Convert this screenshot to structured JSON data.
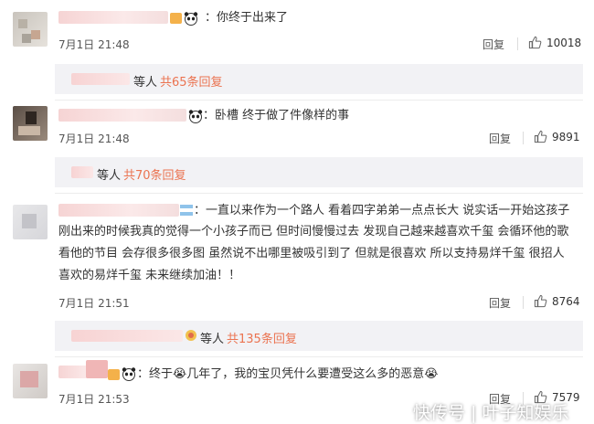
{
  "comments": [
    {
      "text_lines": [
        "你终于出来了"
      ],
      "time": "7月1日 21:48",
      "reply_label": "回复",
      "likes": "10018",
      "sub_replies": {
        "who": "等人",
        "count": "共65条回复"
      }
    },
    {
      "text_lines": [
        "卧槽 终于做了件像样的事"
      ],
      "time": "7月1日 21:48",
      "reply_label": "回复",
      "likes": "9891",
      "sub_replies": {
        "who": "等人",
        "count": "共70条回复"
      }
    },
    {
      "text_lines": [
        "一直以来作为一个路人 看着四字弟弟一点点长大 说实话一开始这孩子",
        "刚出来的时候我真的觉得一个小孩子而已 但时间慢慢过去 发现自己越来越喜欢千玺 会循环他的歌",
        "看他的节目 会存很多很多图 虽然说不出哪里被吸引到了 但就是很喜欢 所以支持易烊千玺 很招人",
        "喜欢的易烊千玺 未来继续加油！！"
      ],
      "time": "7月1日 21:51",
      "reply_label": "回复",
      "likes": "8764",
      "sub_replies": {
        "who": "等人",
        "count": "共135条回复"
      }
    },
    {
      "text_lines": [
        "终于😭几年了，我的宝贝凭什么要遭受这么多的恶意😭"
      ],
      "time": "7月1日 21:53",
      "reply_label": "回复",
      "likes": "7579"
    }
  ],
  "watermark": "快传号 | 叶子知娱乐",
  "colors": {
    "reply_count": "#eb7350",
    "reply_bg": "#f2f2f5"
  }
}
